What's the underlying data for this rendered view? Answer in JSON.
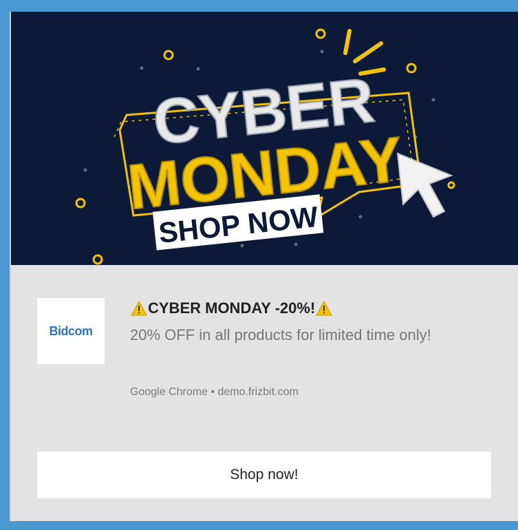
{
  "banner": {
    "line1": "CYBER",
    "line2": "MONDAY",
    "line3": "SHOP NOW",
    "colors": {
      "background": "#0c1a38",
      "accent": "#f5c400",
      "white": "#eeeeee"
    }
  },
  "notification": {
    "logo_text": "Bidcom",
    "title": "CYBER MONDAY -20%!",
    "body": "20% OFF in all products for limited time only!",
    "source": "Google Chrome • demo.frizbit.com",
    "action_label": "Shop now!"
  },
  "theme": {
    "page_bg": "#4a97d2",
    "card_bg": "#e3e3e3"
  }
}
